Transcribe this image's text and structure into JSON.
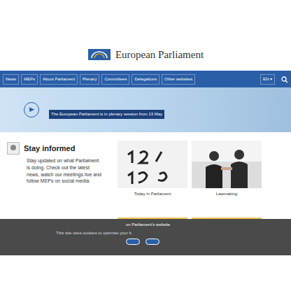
{
  "logo": {
    "title": "European Parliament"
  },
  "nav": {
    "items": [
      "News",
      "MEPs",
      "About Parliament",
      "Plenary",
      "Committees",
      "Delegations",
      "Other websites"
    ],
    "language": "EN ▾"
  },
  "banner": {
    "play": "▶",
    "text": "The European Parliament is in plenary session from 13 May"
  },
  "informed": {
    "heading": "Stay informed",
    "text": "Stay updated on what Parliament is doing. Check out the latest news, watch our meetings live and follow MEPs on social media."
  },
  "cards": [
    {
      "caption": "Today in Parliament",
      "kind": "calendar"
    },
    {
      "caption": "Lawmaking",
      "kind": "photo"
    }
  ],
  "cookie": {
    "title": "on Parliament's website",
    "text": "This site uses cookies to optimise your b",
    "buttons": 2
  }
}
